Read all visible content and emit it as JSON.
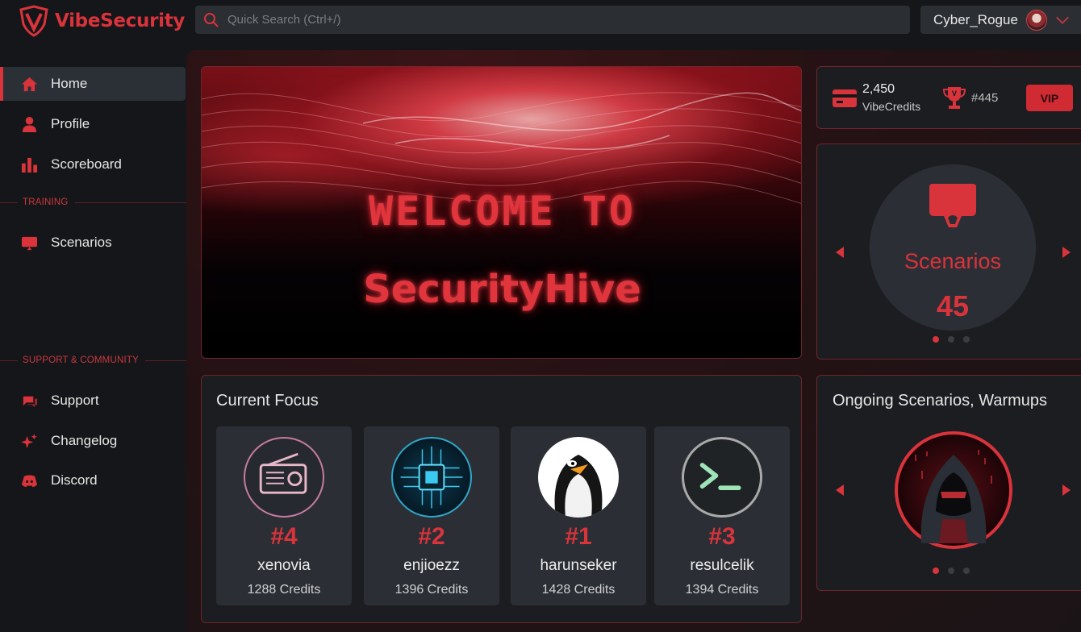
{
  "app": {
    "brand": "VibeSecurity",
    "search_placeholder": "Quick Search (Ctrl+/)",
    "username": "Cyber_Rogue"
  },
  "sidebar": {
    "items": [
      {
        "label": "Home",
        "icon": "home-icon"
      },
      {
        "label": "Profile",
        "icon": "user-icon"
      },
      {
        "label": "Scoreboard",
        "icon": "bar-chart-icon"
      }
    ],
    "training_label": "TRAINING",
    "training_items": [
      {
        "label": "Scenarios",
        "icon": "monitor-icon"
      }
    ],
    "support_label": "SUPPORT & COMMUNITY",
    "support_items": [
      {
        "label": "Support",
        "icon": "chat-icon"
      },
      {
        "label": "Changelog",
        "icon": "sparkle-icon"
      },
      {
        "label": "Discord",
        "icon": "discord-icon"
      }
    ]
  },
  "hero": {
    "line1": "WELCOME TO",
    "line2": "SecurityHive"
  },
  "stats": {
    "credits": "2,450",
    "credits_unit": "VibeCredits",
    "rank": "#445",
    "vip_label": "VIP"
  },
  "scenarios_carousel": {
    "label": "Scenarios",
    "count": "45",
    "active_slide": 1,
    "slides": 3
  },
  "focus": {
    "title": "Current Focus",
    "players": [
      {
        "rank": "#4",
        "name": "xenovia",
        "credits": "1288 Credits"
      },
      {
        "rank": "#2",
        "name": "enjioezz",
        "credits": "1396 Credits"
      },
      {
        "rank": "#1",
        "name": "harunseker",
        "credits": "1428 Credits"
      },
      {
        "rank": "#3",
        "name": "resulcelik",
        "credits": "1394 Credits"
      }
    ]
  },
  "ongoing": {
    "title": "Ongoing Scenarios, Warmups",
    "active_slide": 1,
    "slides": 3
  },
  "colors": {
    "accent": "#d9333b",
    "background": "#151619",
    "card": "#2b2f35",
    "border": "#6e262b"
  }
}
